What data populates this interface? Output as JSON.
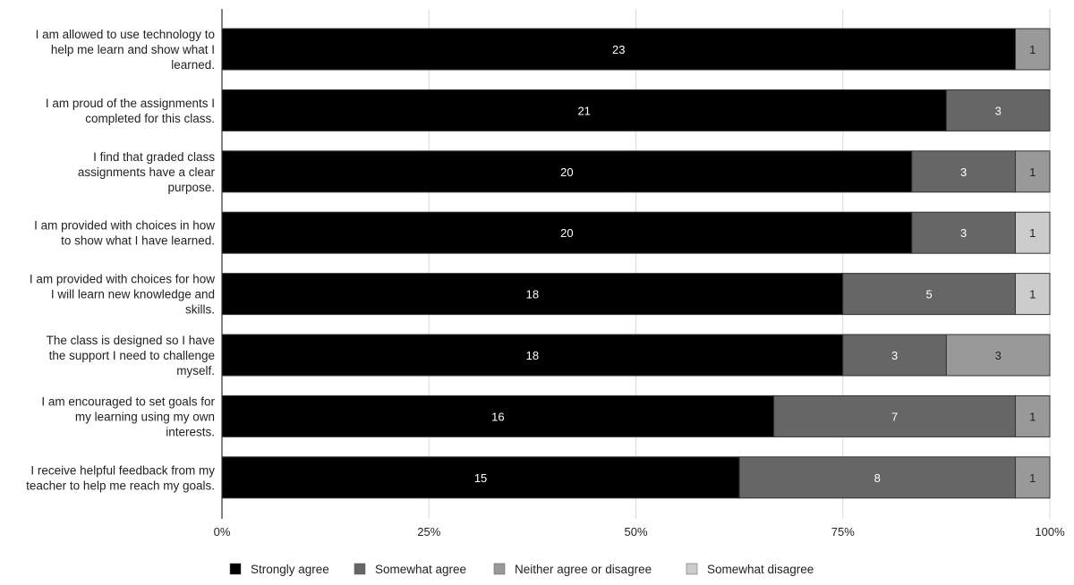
{
  "chart_data": {
    "type": "bar",
    "orientation": "horizontal",
    "stacked": "percent",
    "title": "",
    "xlabel": "",
    "ylabel": "",
    "xlim": [
      0,
      100
    ],
    "x_ticks": [
      "0%",
      "25%",
      "50%",
      "75%",
      "100%"
    ],
    "grid": true,
    "legend_position": "bottom",
    "categories": [
      [
        "I am allowed to use technology to",
        "help me learn and show what I",
        "learned."
      ],
      [
        "I am proud of the assignments I",
        "completed for this class."
      ],
      [
        "I find that graded class",
        "assignments have a clear",
        "purpose."
      ],
      [
        "I am provided with choices in how",
        "to show what I have learned."
      ],
      [
        "I am provided with choices for how",
        "I will learn new knowledge and",
        "skills."
      ],
      [
        "The class is designed so I have",
        "the support I need to challenge",
        "myself."
      ],
      [
        "I am encouraged to set goals for",
        "my learning using my own",
        "interests."
      ],
      [
        "I receive helpful feedback from my",
        "teacher to help me reach my goals."
      ]
    ],
    "series": [
      {
        "name": "Strongly agree",
        "color": "#000000",
        "label_color": "#ffffff",
        "values": [
          23,
          21,
          20,
          20,
          18,
          18,
          16,
          15
        ]
      },
      {
        "name": "Somewhat agree",
        "color": "#666666",
        "label_color": "#ffffff",
        "values": [
          0,
          3,
          3,
          3,
          5,
          3,
          7,
          8
        ]
      },
      {
        "name": "Neither agree or disagree",
        "color": "#999999",
        "label_color": "#222222",
        "values": [
          1,
          0,
          1,
          0,
          0,
          3,
          1,
          1
        ]
      },
      {
        "name": "Somewhat disagree",
        "color": "#cccccc",
        "label_color": "#222222",
        "values": [
          0,
          0,
          0,
          1,
          1,
          0,
          0,
          0
        ]
      }
    ]
  }
}
